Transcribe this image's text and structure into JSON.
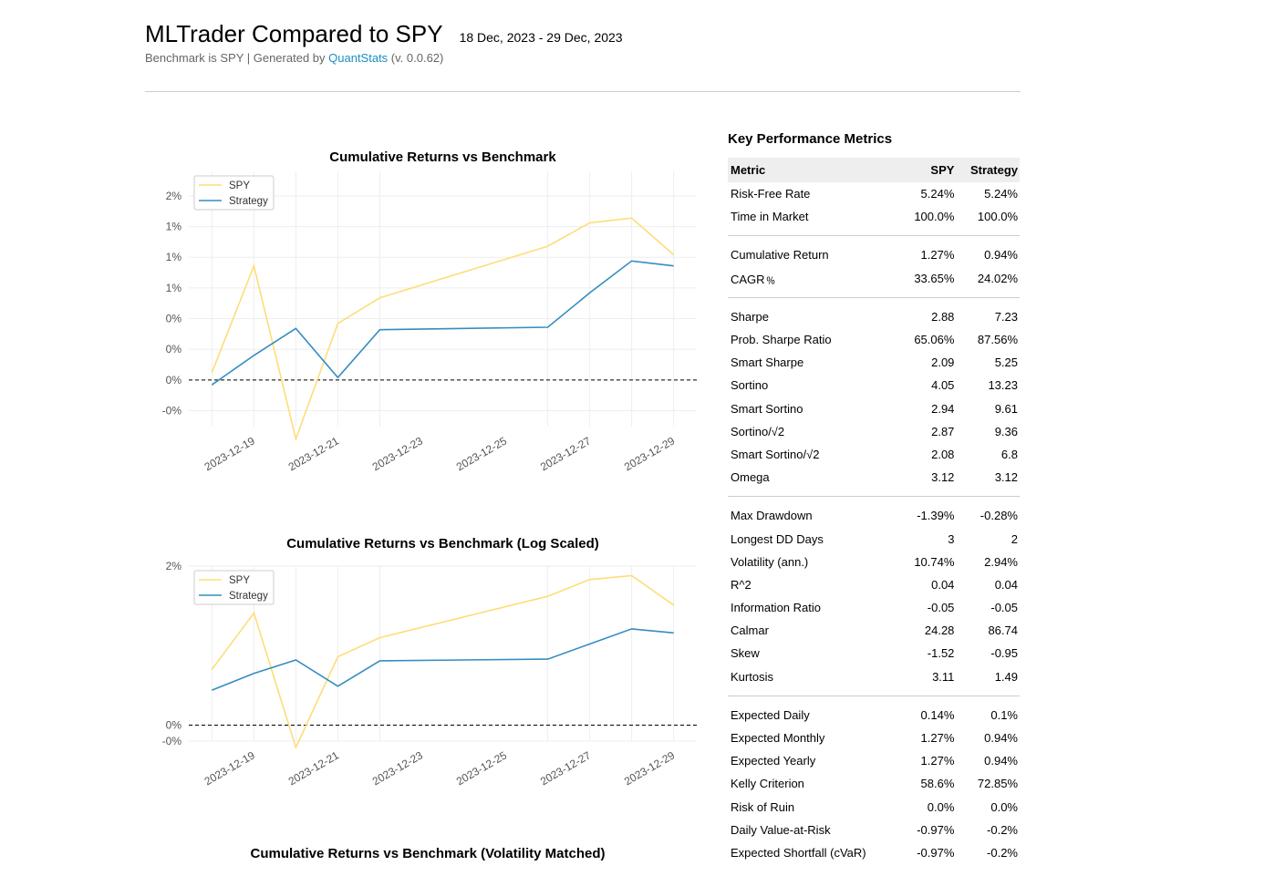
{
  "header": {
    "title": "MLTrader Compared to SPY",
    "date_range": "18 Dec, 2023 - 29 Dec, 2023",
    "subtitle_prefix": "Benchmark is SPY | Generated by ",
    "subtitle_link": "QuantStats",
    "subtitle_suffix": " (v. 0.0.62)"
  },
  "colors": {
    "spy": "#fedd78",
    "strategy": "#348dc1",
    "grid": "#eeeeee",
    "zero_line": "#000000"
  },
  "chart_data": [
    {
      "type": "line",
      "title": "Cumulative Returns vs Benchmark",
      "x": [
        "2023-12-18",
        "2023-12-19",
        "2023-12-20",
        "2023-12-21",
        "2023-12-22",
        "2023-12-26",
        "2023-12-27",
        "2023-12-28",
        "2023-12-29"
      ],
      "xticks": [
        "2023-12-19",
        "2023-12-21",
        "2023-12-23",
        "2023-12-25",
        "2023-12-27",
        "2023-12-29"
      ],
      "yticks": [
        "2%",
        "1%",
        "1%",
        "1%",
        "0%",
        "0%",
        "0%",
        "-0%"
      ],
      "ytick_values": [
        1.75,
        1.5,
        1.25,
        1.0,
        0.75,
        0.5,
        0.25,
        0.0
      ],
      "ylim": [
        -0.13,
        1.95
      ],
      "grid": true,
      "legend_position": "top-left",
      "series": [
        {
          "name": "SPY",
          "values": [
            0.31,
            1.18,
            -0.23,
            0.71,
            0.92,
            1.34,
            1.53,
            1.57,
            1.27
          ]
        },
        {
          "name": "Strategy",
          "values": [
            0.21,
            0.45,
            0.67,
            0.27,
            0.66,
            0.68,
            0.96,
            1.22,
            1.18
          ]
        }
      ],
      "zero_line": 0.25
    },
    {
      "type": "line",
      "title": "Cumulative Returns vs Benchmark (Log Scaled)",
      "x": [
        "2023-12-18",
        "2023-12-19",
        "2023-12-20",
        "2023-12-21",
        "2023-12-22",
        "2023-12-26",
        "2023-12-27",
        "2023-12-28",
        "2023-12-29"
      ],
      "xticks": [
        "2023-12-19",
        "2023-12-21",
        "2023-12-23",
        "2023-12-25",
        "2023-12-27",
        "2023-12-29"
      ],
      "yticks": [
        "2%",
        "0%",
        "-0%"
      ],
      "ytick_values": [
        2.0,
        0.0,
        -0.2
      ],
      "ylim": [
        -0.2,
        2.0
      ],
      "y_scale": "log",
      "grid": true,
      "legend_position": "top-left",
      "series": [
        {
          "name": "SPY",
          "values": [
            0.7,
            1.41,
            -0.28,
            0.86,
            1.1,
            1.62,
            1.83,
            1.88,
            1.51
          ]
        },
        {
          "name": "Strategy",
          "values": [
            0.44,
            0.65,
            0.82,
            0.49,
            0.81,
            0.83,
            1.02,
            1.21,
            1.16
          ]
        }
      ],
      "zero_line": 0.0
    },
    {
      "type": "line",
      "title": "Cumulative Returns vs Benchmark (Volatility Matched)"
    }
  ],
  "metrics": {
    "title": "Key Performance Metrics",
    "columns": [
      "Metric",
      "SPY",
      "Strategy"
    ],
    "groups": [
      [
        [
          "Risk-Free Rate",
          "5.24%",
          "5.24%"
        ],
        [
          "Time in Market",
          "100.0%",
          "100.0%"
        ]
      ],
      [
        [
          "Cumulative Return",
          "1.27%",
          "0.94%"
        ],
        [
          "CAGR﹪",
          "33.65%",
          "24.02%"
        ]
      ],
      [
        [
          "Sharpe",
          "2.88",
          "7.23"
        ],
        [
          "Prob. Sharpe Ratio",
          "65.06%",
          "87.56%"
        ],
        [
          "Smart Sharpe",
          "2.09",
          "5.25"
        ],
        [
          "Sortino",
          "4.05",
          "13.23"
        ],
        [
          "Smart Sortino",
          "2.94",
          "9.61"
        ],
        [
          "Sortino/√2",
          "2.87",
          "9.36"
        ],
        [
          "Smart Sortino/√2",
          "2.08",
          "6.8"
        ],
        [
          "Omega",
          "3.12",
          "3.12"
        ]
      ],
      [
        [
          "Max Drawdown",
          "-1.39%",
          "-0.28%"
        ],
        [
          "Longest DD Days",
          "3",
          "2"
        ],
        [
          "Volatility (ann.)",
          "10.74%",
          "2.94%"
        ],
        [
          "R^2",
          "0.04",
          "0.04"
        ],
        [
          "Information Ratio",
          "-0.05",
          "-0.05"
        ],
        [
          "Calmar",
          "24.28",
          "86.74"
        ],
        [
          "Skew",
          "-1.52",
          "-0.95"
        ],
        [
          "Kurtosis",
          "3.11",
          "1.49"
        ]
      ],
      [
        [
          "Expected Daily",
          "0.14%",
          "0.1%"
        ],
        [
          "Expected Monthly",
          "1.27%",
          "0.94%"
        ],
        [
          "Expected Yearly",
          "1.27%",
          "0.94%"
        ],
        [
          "Kelly Criterion",
          "58.6%",
          "72.85%"
        ],
        [
          "Risk of Ruin",
          "0.0%",
          "0.0%"
        ],
        [
          "Daily Value-at-Risk",
          "-0.97%",
          "-0.2%"
        ],
        [
          "Expected Shortfall (cVaR)",
          "-0.97%",
          "-0.2%"
        ]
      ]
    ]
  }
}
